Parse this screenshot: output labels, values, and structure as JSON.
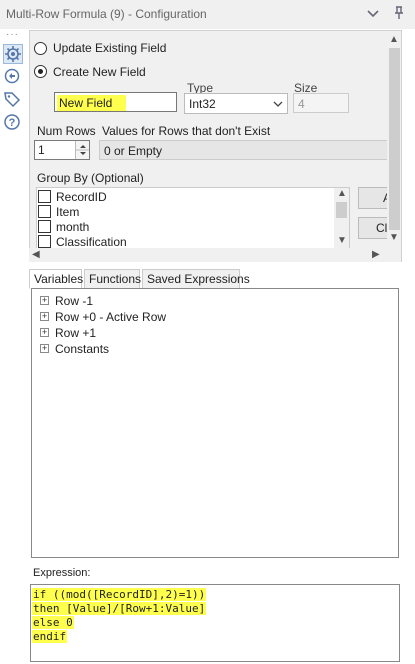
{
  "window": {
    "title": "Multi-Row Formula (9) - Configuration"
  },
  "sidebar": {
    "icons": [
      "gear-icon",
      "target-icon",
      "tag-icon",
      "help-icon"
    ]
  },
  "config": {
    "update_existing_label": "Update Existing Field",
    "create_new_label": "Create New  Field",
    "new_field_value": "New Field",
    "type_label": "Type",
    "type_value": "Int32",
    "size_label": "Size",
    "size_value": "4",
    "num_rows_label": "Num Rows",
    "num_rows_value": "1",
    "values_label": "Values for Rows that don't Exist",
    "values_value": "0 or Empty",
    "group_by_label": "Group By (Optional)",
    "group_by_items": [
      "RecordID",
      "Item",
      "month",
      "Classification"
    ],
    "side_buttons": [
      "A",
      "Cl"
    ]
  },
  "tabs": [
    "Variables",
    "Functions",
    "Saved Expressions"
  ],
  "variables_tree": [
    "Row -1",
    "Row +0 - Active Row",
    "Row +1",
    "Constants"
  ],
  "expression": {
    "label": "Expression:",
    "lines": [
      "if ((mod([RecordID],2)=1))",
      "then [Value]/[Row+1:Value]",
      "else 0",
      "endif"
    ]
  },
  "colors": {
    "highlight": "#ffff4d",
    "panel": "#f0f0f0"
  }
}
